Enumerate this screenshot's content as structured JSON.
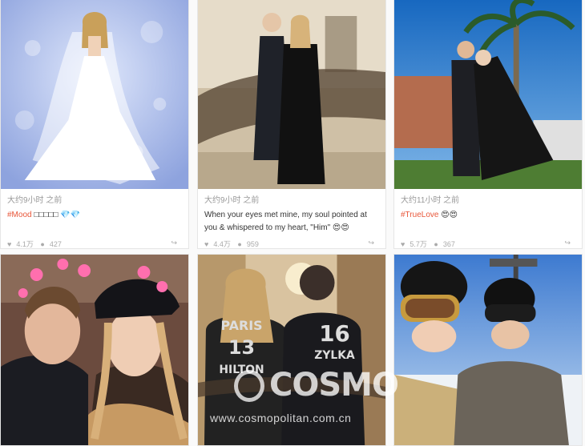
{
  "posts": [
    {
      "time": "大约9小时 之前",
      "tag": "#Mood",
      "caption_rest": " □□□□□ 💎💎",
      "stats": {
        "likes": "4.1万",
        "comments": "427",
        "share_icon": "share-icon"
      }
    },
    {
      "time": "大约9小时 之前",
      "caption": "When your eyes met mine, my soul pointed at you & whispered to my heart, \"Him\" 😍😍",
      "stats": {
        "likes": "4.4万",
        "comments": "959",
        "share_icon": "share-icon"
      }
    },
    {
      "time": "大约11小时 之前",
      "tag": "#TrueLove",
      "caption_rest": " 😍😍",
      "stats": {
        "likes": "5.7万",
        "comments": "367",
        "share_icon": "share-icon"
      }
    }
  ],
  "photo_texts": {
    "jersey_left_name": "PARIS",
    "jersey_left_number": "13",
    "jersey_left_surname": "HILTON",
    "jersey_right_number": "16",
    "jersey_right_surname": "ZYLKA"
  },
  "watermark": {
    "logo": "COSMO",
    "url": "www.cosmopolitan.com.cn"
  },
  "colors": {
    "tag": "#e8573a",
    "sky": "#1b6fc2",
    "bridal_bg": "#9fb4e8"
  }
}
